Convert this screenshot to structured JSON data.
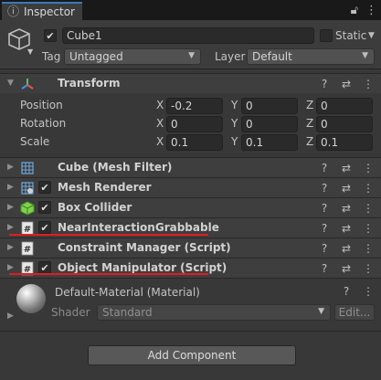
{
  "tab": {
    "icon": "info-icon",
    "label": "Inspector",
    "lock_icon": "lock-icon",
    "menu_icon": "kebab-menu-icon"
  },
  "object": {
    "icon": "cube-icon",
    "active": true,
    "name": "Cube1",
    "static_label": "Static",
    "static_checked": false,
    "tag_label": "Tag",
    "tag_value": "Untagged",
    "layer_label": "Layer",
    "layer_value": "Default"
  },
  "transform": {
    "title": "Transform",
    "rows": [
      {
        "label": "Position",
        "x": "-0.2",
        "y": "0",
        "z": "0"
      },
      {
        "label": "Rotation",
        "x": "0",
        "y": "0",
        "z": "0"
      },
      {
        "label": "Scale",
        "x": "0.1",
        "y": "0.1",
        "z": "0.1"
      }
    ],
    "axis": {
      "x": "X",
      "y": "Y",
      "z": "Z"
    }
  },
  "components": [
    {
      "title": "Cube (Mesh Filter)",
      "icon": "mesh-filter-icon",
      "has_checkbox": false
    },
    {
      "title": "Mesh Renderer",
      "icon": "mesh-renderer-icon",
      "has_checkbox": true,
      "checked": true
    },
    {
      "title": "Box Collider",
      "icon": "box-collider-icon",
      "has_checkbox": true,
      "checked": true
    },
    {
      "title": "NearInteractionGrabbable",
      "icon": "script-icon",
      "has_checkbox": true,
      "checked": true,
      "highlighted": true
    },
    {
      "title": "Constraint Manager (Script)",
      "icon": "script-icon",
      "has_checkbox": false
    },
    {
      "title": "Object Manipulator (Script)",
      "icon": "script-icon",
      "has_checkbox": true,
      "checked": true,
      "highlighted": true
    }
  ],
  "material": {
    "title": "Default-Material (Material)",
    "shader_label": "Shader",
    "shader_value": "Standard",
    "edit_label": "Edit..."
  },
  "add_component_label": "Add Component",
  "colors": {
    "highlight_underline": "#e01e1e",
    "accent_tab": "#3a79bb",
    "background": "#383838"
  }
}
